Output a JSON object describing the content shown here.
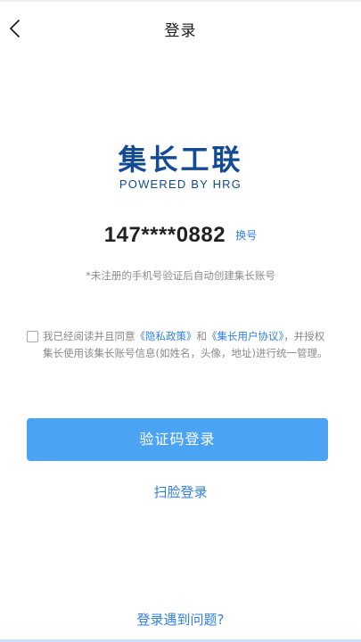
{
  "header": {
    "title": "登录",
    "back_icon": "chevron-left-icon"
  },
  "logo": {
    "brand_name": "集长工联",
    "tagline": "POWERED BY HRG",
    "color": "#134a96"
  },
  "account": {
    "phone": "147****0882",
    "change_label": "换号"
  },
  "hint": "*未注册的手机号验证后自动创建集长账号",
  "agreement": {
    "checked": false,
    "prefix": "我已经阅读并且同意",
    "privacy_link": "《隐私政策》",
    "and": "和",
    "user_agreement_link": "《集长用户协议》",
    "suffix": "，并授权集长使用该集长账号信息(如姓名，头像，地址)进行统一管理。"
  },
  "actions": {
    "sms_login_label": "验证码登录",
    "face_login_label": "扫脸登录",
    "trouble_label": "登录遇到问题?"
  },
  "colors": {
    "accent": "#2f7fe0",
    "primary_button": "#4aa3f3",
    "muted_text": "#8c8c8c"
  }
}
